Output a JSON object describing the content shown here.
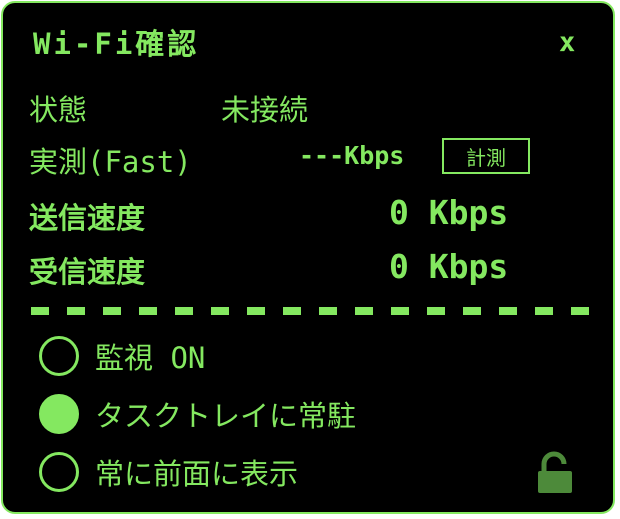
{
  "window": {
    "title": "Wi-Fi確認",
    "close_glyph": "x"
  },
  "status": {
    "label": "状態",
    "value": "未接続"
  },
  "measured": {
    "label": "実測(Fast)",
    "value": "---Kbps",
    "button_label": "計測"
  },
  "send": {
    "label": "送信速度",
    "value": "0 Kbps"
  },
  "receive": {
    "label": "受信速度",
    "value": "0 Kbps"
  },
  "options": [
    {
      "label": "監視 ON",
      "checked": false
    },
    {
      "label": "タスクトレイに常駐",
      "checked": true
    },
    {
      "label": "常に前面に表示",
      "checked": false
    }
  ],
  "lock": {
    "icon": "unlock-icon",
    "state": "unlocked"
  },
  "colors": {
    "accent": "#84e860",
    "lock": "#4d8a3a",
    "background": "#000000"
  }
}
